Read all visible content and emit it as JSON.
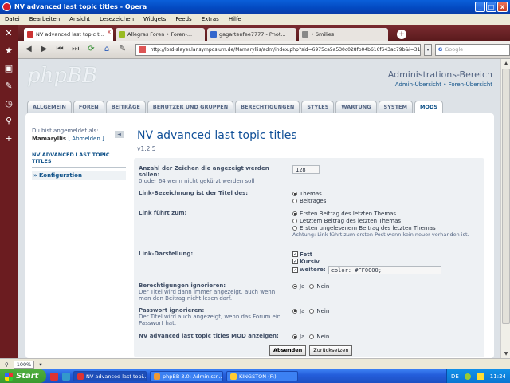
{
  "window": {
    "title": "NV advanced last topic titles - Opera",
    "min": "_",
    "max": "□",
    "close": "x"
  },
  "menu": [
    "Datei",
    "Bearbeiten",
    "Ansicht",
    "Lesezeichen",
    "Widgets",
    "Feeds",
    "Extras",
    "Hilfe"
  ],
  "browser_tabs": [
    {
      "label": "NV advanced last topic t...",
      "active": true
    },
    {
      "label": "Allegras Foren • Foren-...",
      "active": false
    },
    {
      "label": "gagartenfee7777 - Phot...",
      "active": false
    },
    {
      "label": "• Smilies",
      "active": false
    }
  ],
  "tab_close": "x",
  "tab_new": "+",
  "nav": {
    "url": "http://lord-slayer.lansymposium.de/Mamaryllis/adm/index.php?sid=6975ca5a530c028fb04b616f643ac79b&i=31",
    "search_placeholder": "Google",
    "search_brand": "G",
    "url_drop": "▾",
    "reload": "⟳",
    "home": "⌂",
    "back": "◀",
    "forward": "▶",
    "rewind": "⏮",
    "ffwd": "⏭",
    "pen": "✎"
  },
  "side_icons": {
    "tools": "✕",
    "star": "★",
    "downloads": "▣",
    "notes": "✎",
    "history": "◷",
    "search": "⚲",
    "add": "+"
  },
  "header": {
    "logo": "phpBB",
    "title": "Administrations-Bereich",
    "links": "Admin-Übersicht • Foren-Übersicht"
  },
  "tabs": [
    "ALLGEMEIN",
    "FOREN",
    "BEITRÄGE",
    "BENUTZER UND GRUPPEN",
    "BERECHTIGUNGEN",
    "STYLES",
    "WARTUNG",
    "SYSTEM",
    "MODS"
  ],
  "active_tab": "MODS",
  "user": {
    "logged_in_label": "Du bist angemeldet als:",
    "name": "Mamaryllis",
    "logout": "[ Abmelden ]",
    "toggle": "◄"
  },
  "sidemenu": {
    "heading": "NV ADVANCED LAST TOPIC TITLES",
    "item": "» Konfiguration"
  },
  "mod": {
    "title": "NV advanced last topic titles",
    "version": "v1.2.5"
  },
  "form": {
    "chars_label": "Anzahl der Zeichen die angezeigt werden sollen:",
    "chars_hint": "0 oder 64 wenn nicht gekürzt werden soll",
    "chars_value": "128",
    "linktitle_label": "Link-Bezeichnung ist der Titel des:",
    "linktitle_opts": [
      "Themas",
      "Beitrages"
    ],
    "linkto_label": "Link führt zum:",
    "linkto_opts": [
      "Ersten Beitrag des letzten Themas",
      "Letztem Beitrag des letzten Themas",
      "Ersten ungelesenem Beitrag des letzten Themas"
    ],
    "linkto_note": "Achtung: Link führt zum ersten Post wenn kein neuer vorhanden ist.",
    "display_label": "Link-Darstellung:",
    "display_opts": [
      "Fett",
      "Kursiv",
      "weitere:"
    ],
    "display_extra_value": "color: #FF0000;",
    "check_mark": "✓",
    "perm_label": "Berechtigungen ignorieren:",
    "perm_hint": "Der Titel wird dann immer angezeigt, auch wenn man den Beitrag nicht lesen darf.",
    "pw_label": "Passwort ignorieren:",
    "pw_hint": "Der Titel wird auch angezeigt, wenn das Forum ein Passwort hat.",
    "show_label": "NV advanced last topic titles MOD anzeigen:",
    "yes": "Ja",
    "no": "Nein",
    "submit": "Absenden",
    "reset": "Zurücksetzen"
  },
  "scroll_arrows": {
    "up": "▲",
    "down": "▼"
  },
  "statusbar": {
    "zoom": "100%",
    "zoom_drop": "▾",
    "zoom_icon": "⚲"
  },
  "taskbar": {
    "start": "Start",
    "tasks": [
      "NV advanced last topi...",
      "phpBB 3.0: Administr...",
      "KINGSTON (F:)"
    ],
    "lang": "DE",
    "clock": "11:24"
  },
  "colors": {
    "accent": "#105289",
    "titlebar": "#0a5fd9",
    "opera_bar": "#6b1c20"
  }
}
